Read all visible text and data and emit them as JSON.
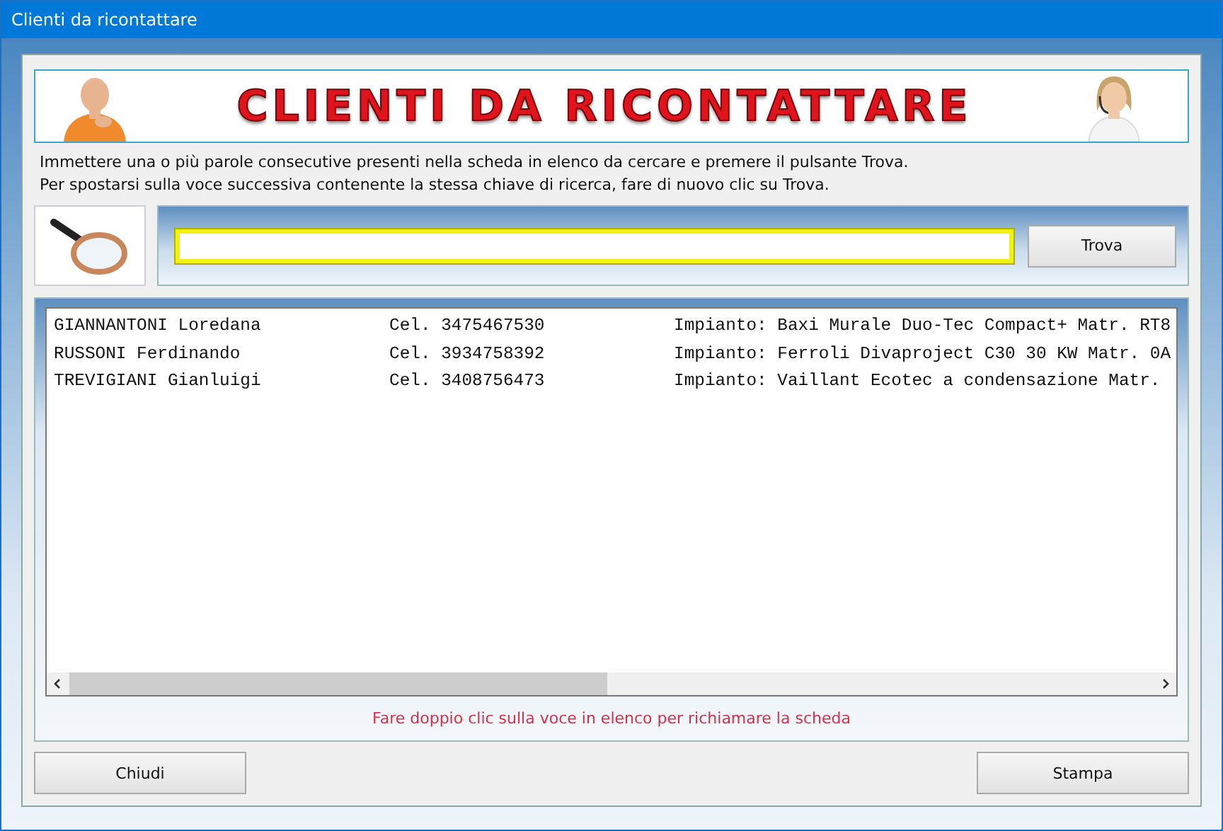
{
  "window": {
    "title": "Clienti da ricontattare"
  },
  "banner": {
    "title": "CLIENTI DA RICONTATTARE"
  },
  "instructions": [
    "Immettere una o più parole consecutive presenti nella scheda in elenco da cercare e premere il pulsante Trova.",
    "Per spostarsi sulla voce successiva contenente la stessa chiave di ricerca, fare di nuovo clic su Trova."
  ],
  "search": {
    "focused": true,
    "button": "Trova"
  },
  "list": {
    "rows": [
      {
        "name": "GIANNANTONI Loredana",
        "phone": "Cel. 3475467530",
        "system": "Impianto: Baxi Murale Duo-Tec Compact+ Matr. RT8"
      },
      {
        "name": "RUSSONI Ferdinando",
        "phone": "Cel. 3934758392",
        "system": "Impianto: Ferroli Divaproject C30 30 KW Matr. 0A"
      },
      {
        "name": "TREVIGIANI Gianluigi",
        "phone": "Cel. 3408756473",
        "system": "Impianto: Vaillant Ecotec a condensazione Matr."
      }
    ]
  },
  "hint": "Fare doppio clic sulla voce in elenco per richiamare la scheda",
  "buttons": [
    "Chiudi",
    "Stampa"
  ]
}
